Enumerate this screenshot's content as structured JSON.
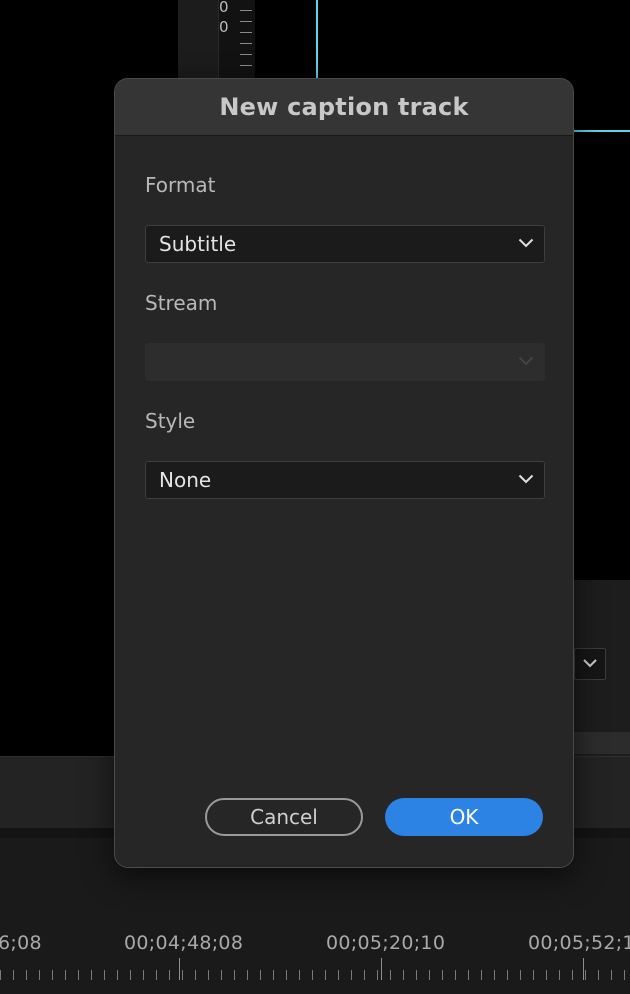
{
  "dialog": {
    "title": "New caption track",
    "format": {
      "label": "Format",
      "value": "Subtitle"
    },
    "stream": {
      "label": "Stream",
      "value": ""
    },
    "style": {
      "label": "Style",
      "value": "None"
    },
    "cancel_label": "Cancel",
    "ok_label": "OK"
  },
  "background": {
    "meter_values": [
      "0",
      "0"
    ],
    "timecodes": [
      "6;08",
      "00;04;48;08",
      "00;05;20;10",
      "00;05;52;1"
    ]
  },
  "colors": {
    "accent": "#2d83e4",
    "guide": "#5fd5e8"
  },
  "icons": [
    "chevron-down-icon"
  ]
}
